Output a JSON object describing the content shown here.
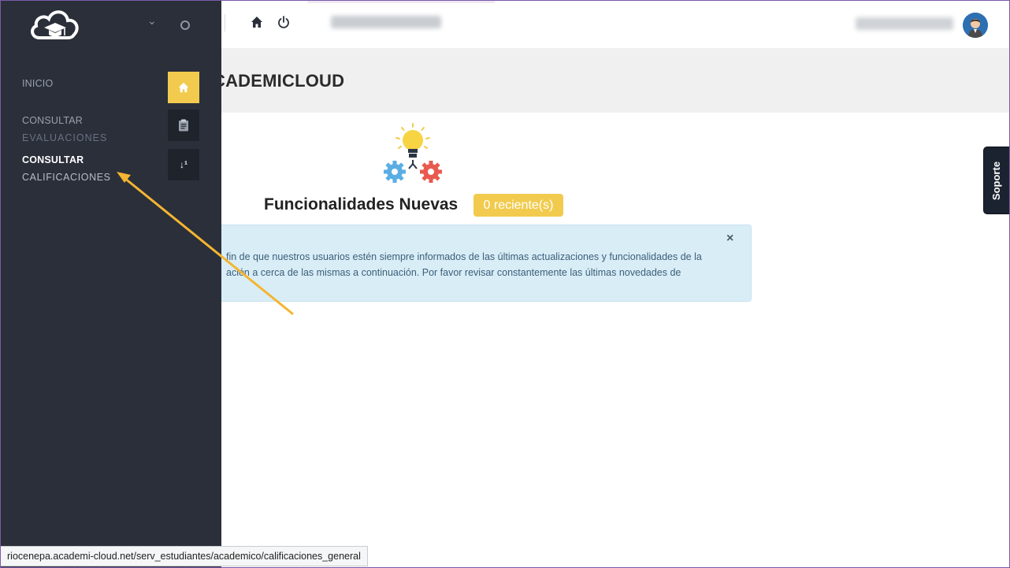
{
  "topbar": {
    "collapse_icon": "chevron-down-icon",
    "circle_icon": "circle-icon",
    "home_icon": "home-icon",
    "power_icon": "power-icon"
  },
  "sidebar": {
    "items": [
      {
        "line1": "INICIO",
        "icon": "home-icon"
      },
      {
        "line1": "CONSULTAR",
        "line2": "EVALUACIONES",
        "icon": "clipboard-icon"
      },
      {
        "line1": "CONSULTAR",
        "line2": "CALIFICACIONES",
        "icon": "sort-numeric-icon",
        "icon_text": "↓¹"
      }
    ]
  },
  "header": {
    "title": "CADEMICLOUD"
  },
  "features": {
    "title": "Funcionalidades Nuevas",
    "badge": "0 reciente(s)",
    "alert_line1": "fin de que nuestros usuarios estén siempre informados de las últimas actualizaciones y funcionalidades de la",
    "alert_line2": "ación a cerca de las mismas a continuación. Por favor revisar constantemente las últimas novedades de",
    "close_symbol": "×"
  },
  "support": {
    "label": "Soporte"
  },
  "statusbar": {
    "url": "riocenepa.academi-cloud.net/serv_estudiantes/academico/calificaciones_general"
  },
  "colors": {
    "sidebar_bg": "#2a2f3a",
    "accent_yellow": "#f2cb4e",
    "alert_bg": "#d9edf7",
    "annotation_arrow": "#f4b531"
  }
}
